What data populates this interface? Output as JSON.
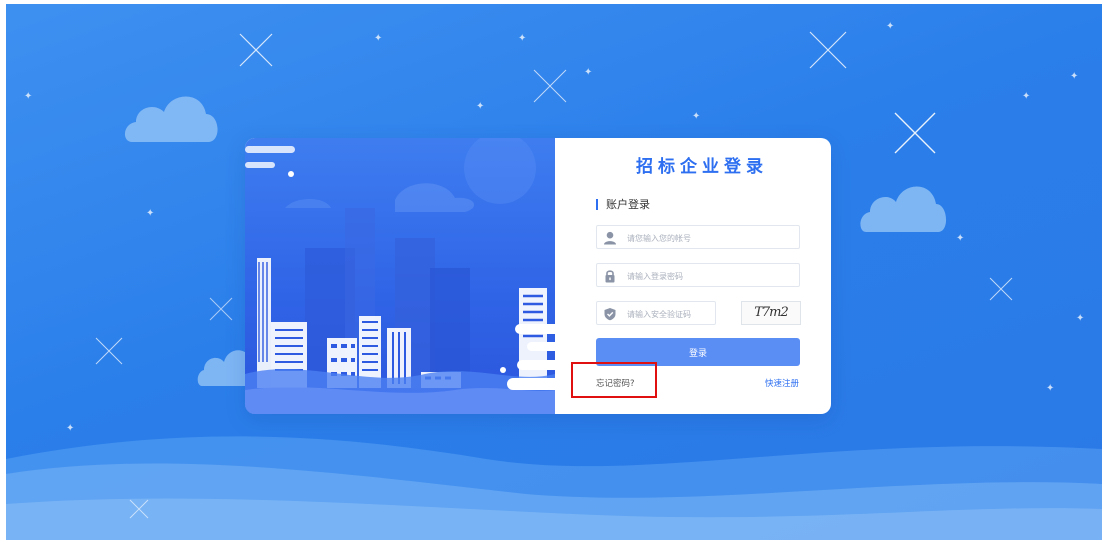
{
  "page": {
    "title": "招标企业登录",
    "section_label": "账户登录"
  },
  "form": {
    "account_placeholder": "请您输入您的帐号",
    "password_placeholder": "请输入登录密码",
    "captcha_placeholder": "请输入安全验证码",
    "captcha_text": "T7m2",
    "login_label": "登录",
    "forgot_label": "忘记密码?",
    "register_label": "快速注册"
  },
  "colors": {
    "background": "#2b7fea",
    "accent": "#2d6ff0",
    "button": "#5b8ef5",
    "highlight": "#e01010"
  },
  "icons": {
    "account": "user-icon",
    "password": "lock-icon",
    "captcha": "shield-icon"
  }
}
